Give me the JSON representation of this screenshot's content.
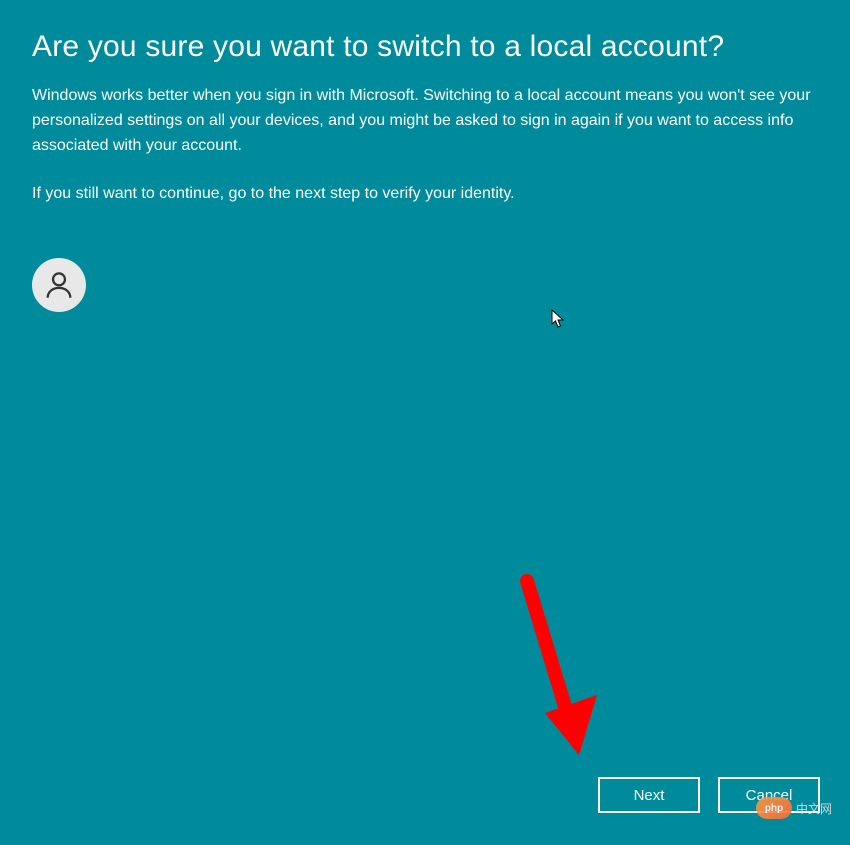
{
  "dialog": {
    "title": "Are you sure you want to switch to a local account?",
    "description": "Windows works better when you sign in with Microsoft. Switching to a local account means you won't see your personalized settings on all your devices, and you might be asked to sign in again if you want to access info associated with your account.",
    "continue_text": "If you still want to continue, go to the next step to verify your identity."
  },
  "buttons": {
    "next": "Next",
    "cancel": "Cancel"
  },
  "watermark": {
    "logo_text": "php",
    "site_text": "中文网"
  }
}
